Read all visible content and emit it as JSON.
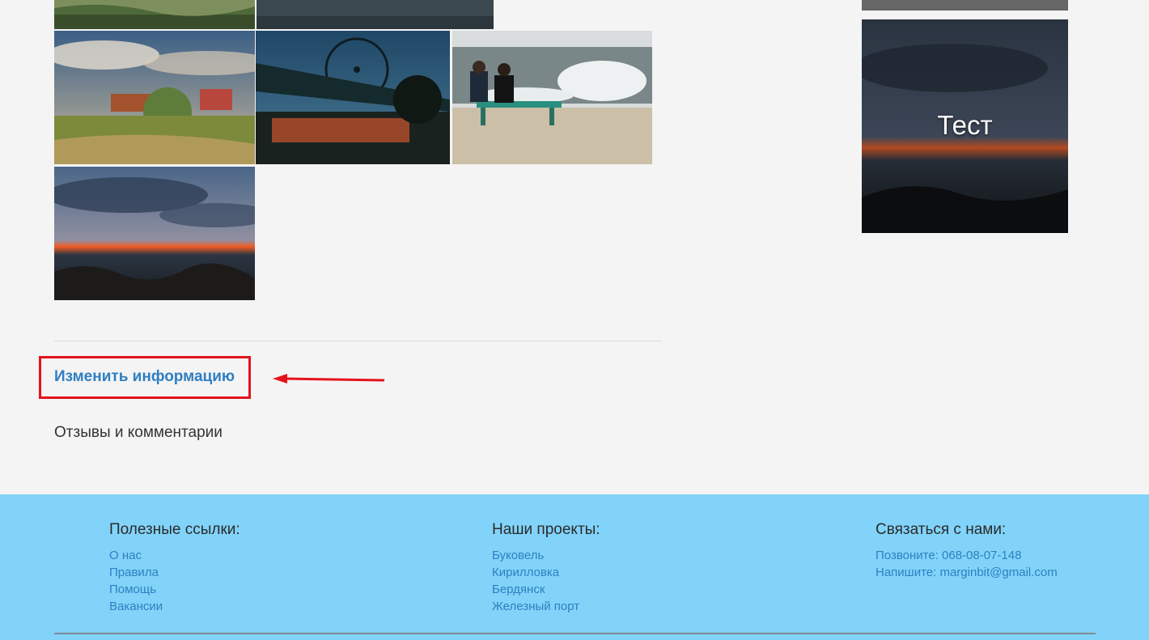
{
  "content": {
    "edit_link": "Изменить информацию",
    "reviews_heading": "Отзывы и комментарии"
  },
  "sidebar": {
    "card_label": "Тест"
  },
  "footer": {
    "useful": {
      "title": "Полезные ссылки:",
      "links": [
        "О нас",
        "Правила",
        "Помощь",
        "Вакансии"
      ]
    },
    "projects": {
      "title": "Наши проекты:",
      "links": [
        "Буковель",
        "Кирилловка",
        "Бердянск",
        "Железный порт"
      ]
    },
    "contact": {
      "title": "Связаться с нами:",
      "links": [
        "Позвоните: 068-08-07-148",
        "Напишите: marginbit@gmail.com"
      ]
    }
  },
  "colors": {
    "link": "#2f7fc1",
    "footer_bg": "#81d3f9",
    "highlight": "#e5121a"
  }
}
